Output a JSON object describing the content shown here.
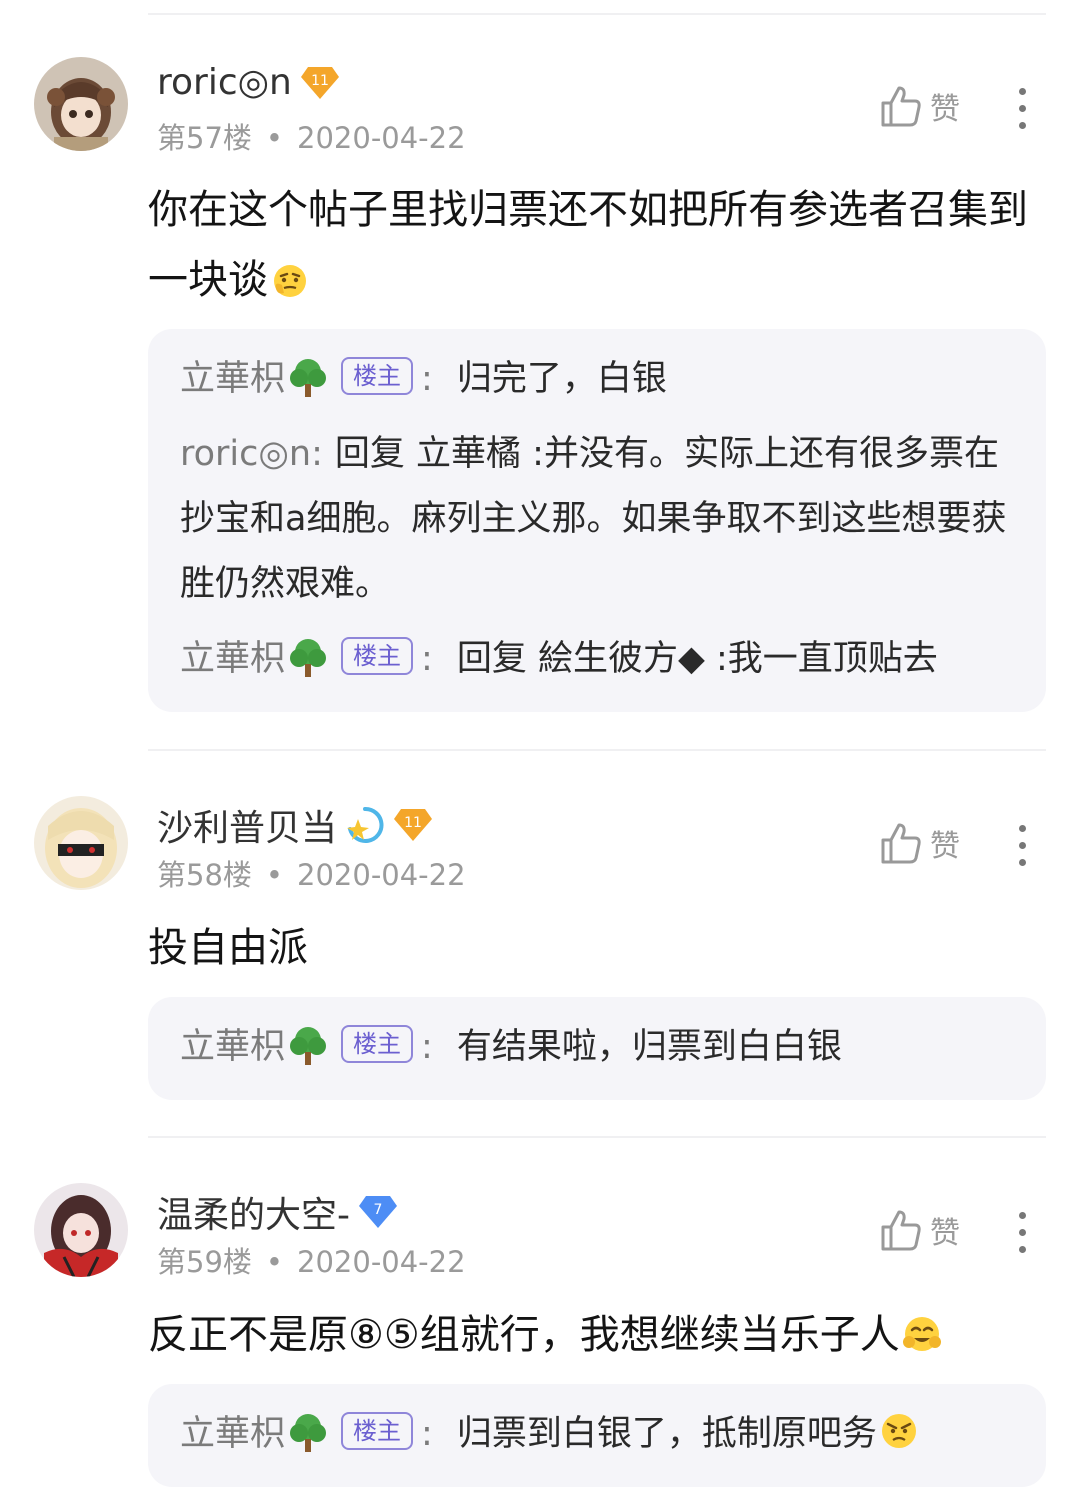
{
  "posts": [
    {
      "username": "roric◎n",
      "level": "11",
      "floor": "第57楼",
      "separator": "•",
      "date": "2020-04-22",
      "like_label": "赞",
      "content": "你在这个帖子里找归票还不如把所有参选者召集到一块谈",
      "replies": [
        {
          "name": "立華枳",
          "is_op": true,
          "op_label": "楼主",
          "colon": ":",
          "text": "归完了，白银"
        },
        {
          "name": "roric◎n",
          "is_op": false,
          "op_label": "",
          "colon": ":",
          "text": "回复 立華橘 :并没有。实际上还有很多票在抄宝和a细胞。麻列主义那。如果争取不到这些想要获胜仍然艰难。"
        },
        {
          "name": "立華枳",
          "is_op": true,
          "op_label": "楼主",
          "colon": ":",
          "text": "回复 絵生彼方◆ :我一直顶贴去"
        }
      ]
    },
    {
      "username": "沙利普贝当",
      "level": "11",
      "floor": "第58楼",
      "separator": "•",
      "date": "2020-04-22",
      "like_label": "赞",
      "content": "投自由派",
      "replies": [
        {
          "name": "立華枳",
          "is_op": true,
          "op_label": "楼主",
          "colon": ":",
          "text": "有结果啦，归票到白白银"
        }
      ]
    },
    {
      "username": "温柔的大空-",
      "level": "7",
      "floor": "第59楼",
      "separator": "•",
      "date": "2020-04-22",
      "like_label": "赞",
      "content": "反正不是原⑧⑤组就行，我想继续当乐子人",
      "replies": [
        {
          "name": "立華枳",
          "is_op": true,
          "op_label": "楼主",
          "colon": ":",
          "text": "归票到白银了，抵制原吧务"
        }
      ]
    }
  ],
  "colors": {
    "level_gold": "#f4a62a",
    "level_blue": "#4d8df5",
    "op_badge": "#6b5fd0",
    "reply_bg": "#f5f5f9"
  }
}
